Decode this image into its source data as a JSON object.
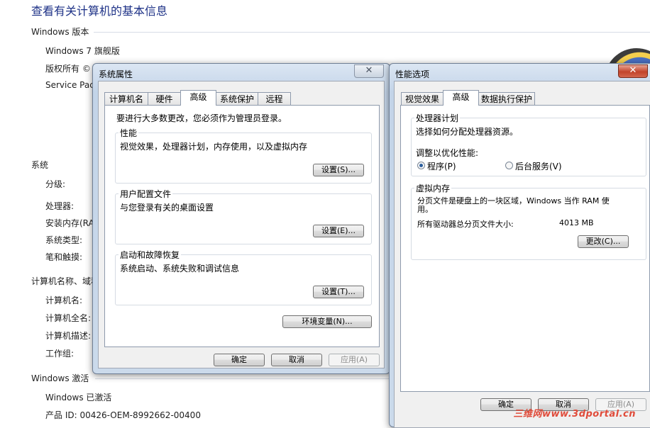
{
  "background": {
    "title": "查看有关计算机的基本信息",
    "sections": {
      "edition": "Windows 版本",
      "system": "系统",
      "computer": "计算机名称、域和",
      "activation": "Windows 激活"
    },
    "edition_rows": [
      "Windows 7 旗舰版",
      "版权所有 ©",
      "Service Pac"
    ],
    "system_rows": [
      "分级:",
      "处理器:",
      "安装内存(RAM",
      "系统类型:",
      "笔和触摸:"
    ],
    "computer_rows": [
      "计算机名:",
      "计算机全名:",
      "计算机描述:",
      "工作组:"
    ],
    "activation_rows": [
      "Windows 已激活",
      "产品 ID: 00426-OEM-8992662-00400"
    ]
  },
  "sysprops": {
    "title": "系统属性",
    "close": "✕",
    "tabs": [
      "计算机名",
      "硬件",
      "高级",
      "系统保护",
      "远程"
    ],
    "admin_note": "要进行大多数更改，您必须作为管理员登录。",
    "performance": {
      "label": "性能",
      "desc": "视觉效果，处理器计划，内存使用，以及虚拟内存",
      "button": "设置(S)..."
    },
    "profile": {
      "label": "用户配置文件",
      "desc": "与您登录有关的桌面设置",
      "button": "设置(E)..."
    },
    "startup": {
      "label": "启动和故障恢复",
      "desc": "系统启动、系统失败和调试信息",
      "button": "设置(T)..."
    },
    "env_button": "环境变量(N)...",
    "ok": "确定",
    "cancel": "取消",
    "apply": "应用(A)"
  },
  "perfopts": {
    "title": "性能选项",
    "close": "✕",
    "tabs": [
      "视觉效果",
      "高级",
      "数据执行保护"
    ],
    "cpu": {
      "label": "处理器计划",
      "desc": "选择如何分配处理器资源。",
      "adjust": "调整以优化性能:",
      "opt_programs": "程序(P)",
      "opt_services": "后台服务(V)",
      "selected": "opt_programs"
    },
    "vm": {
      "label": "虚拟内存",
      "desc_line1": "分页文件是硬盘上的一块区域，Windows 当作 RAM 使",
      "desc_line2": "用。",
      "total_label": "所有驱动器总分页文件大小:",
      "total_value": "4013 MB",
      "button": "更改(C)..."
    },
    "ok": "确定",
    "cancel": "取消",
    "apply": "应用(A)"
  },
  "watermark": "三维网www.3dportal.cn"
}
